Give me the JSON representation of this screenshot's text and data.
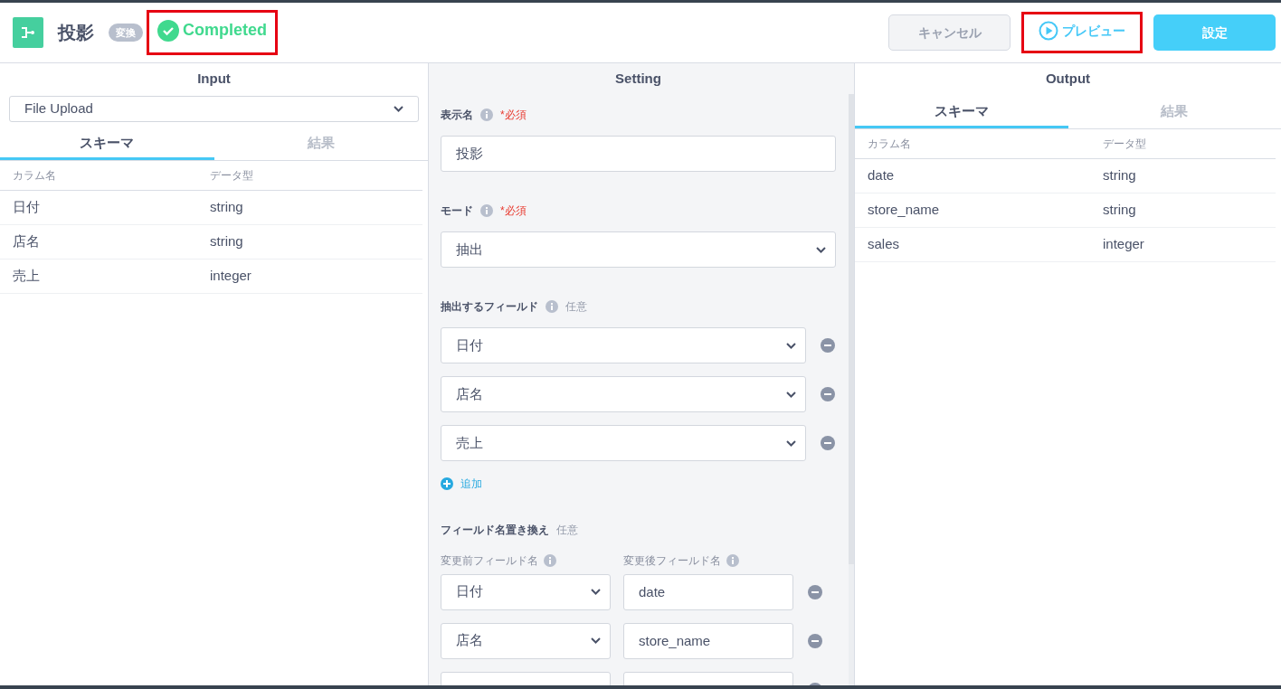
{
  "header": {
    "title": "投影",
    "category_badge": "変換",
    "status": {
      "label": "Completed",
      "highlighted": true
    },
    "buttons": [
      {
        "kind": "secondary",
        "label": "キャンセル",
        "highlighted": false
      },
      {
        "kind": "preview",
        "label": "プレビュー",
        "highlighted": true
      },
      {
        "kind": "primary",
        "label": "設定",
        "highlighted": false
      }
    ]
  },
  "input": {
    "title": "Input",
    "source": "File Upload",
    "tabs": [
      {
        "label": "スキーマ",
        "selected": true
      },
      {
        "label": "結果",
        "selected": false
      }
    ],
    "columns": [
      "カラム名",
      "データ型"
    ],
    "rows": [
      [
        "日付",
        "string"
      ],
      [
        "店名",
        "string"
      ],
      [
        "売上",
        "integer"
      ]
    ]
  },
  "setting": {
    "title": "Setting",
    "fields": [
      {
        "kind": "text",
        "label": "表示名",
        "info": true,
        "requirement": "*必須",
        "required": true,
        "value": "投影"
      },
      {
        "kind": "select",
        "label": "モード",
        "info": true,
        "requirement": "*必須",
        "required": true,
        "value": "抽出"
      },
      {
        "kind": "list",
        "label": "抽出するフィールド",
        "info": true,
        "requirement": "任意",
        "required": false,
        "items": [
          "日付",
          "店名",
          "売上"
        ],
        "add_label": "追加"
      },
      {
        "kind": "rename",
        "label": "フィールド名置き換え",
        "info": false,
        "requirement": "任意",
        "required": false,
        "before_label": "変更前フィールド名",
        "after_label": "変更後フィールド名",
        "rows": [
          {
            "before": "日付",
            "after": "date"
          },
          {
            "before": "店名",
            "after": "store_name"
          },
          {}
        ]
      }
    ]
  },
  "output": {
    "title": "Output",
    "tabs": [
      {
        "label": "スキーマ",
        "selected": true
      },
      {
        "label": "結果",
        "selected": false
      }
    ],
    "columns": [
      "カラム名",
      "データ型"
    ],
    "rows": [
      [
        "date",
        "string"
      ],
      [
        "store_name",
        "string"
      ],
      [
        "sales",
        "integer"
      ]
    ]
  }
}
